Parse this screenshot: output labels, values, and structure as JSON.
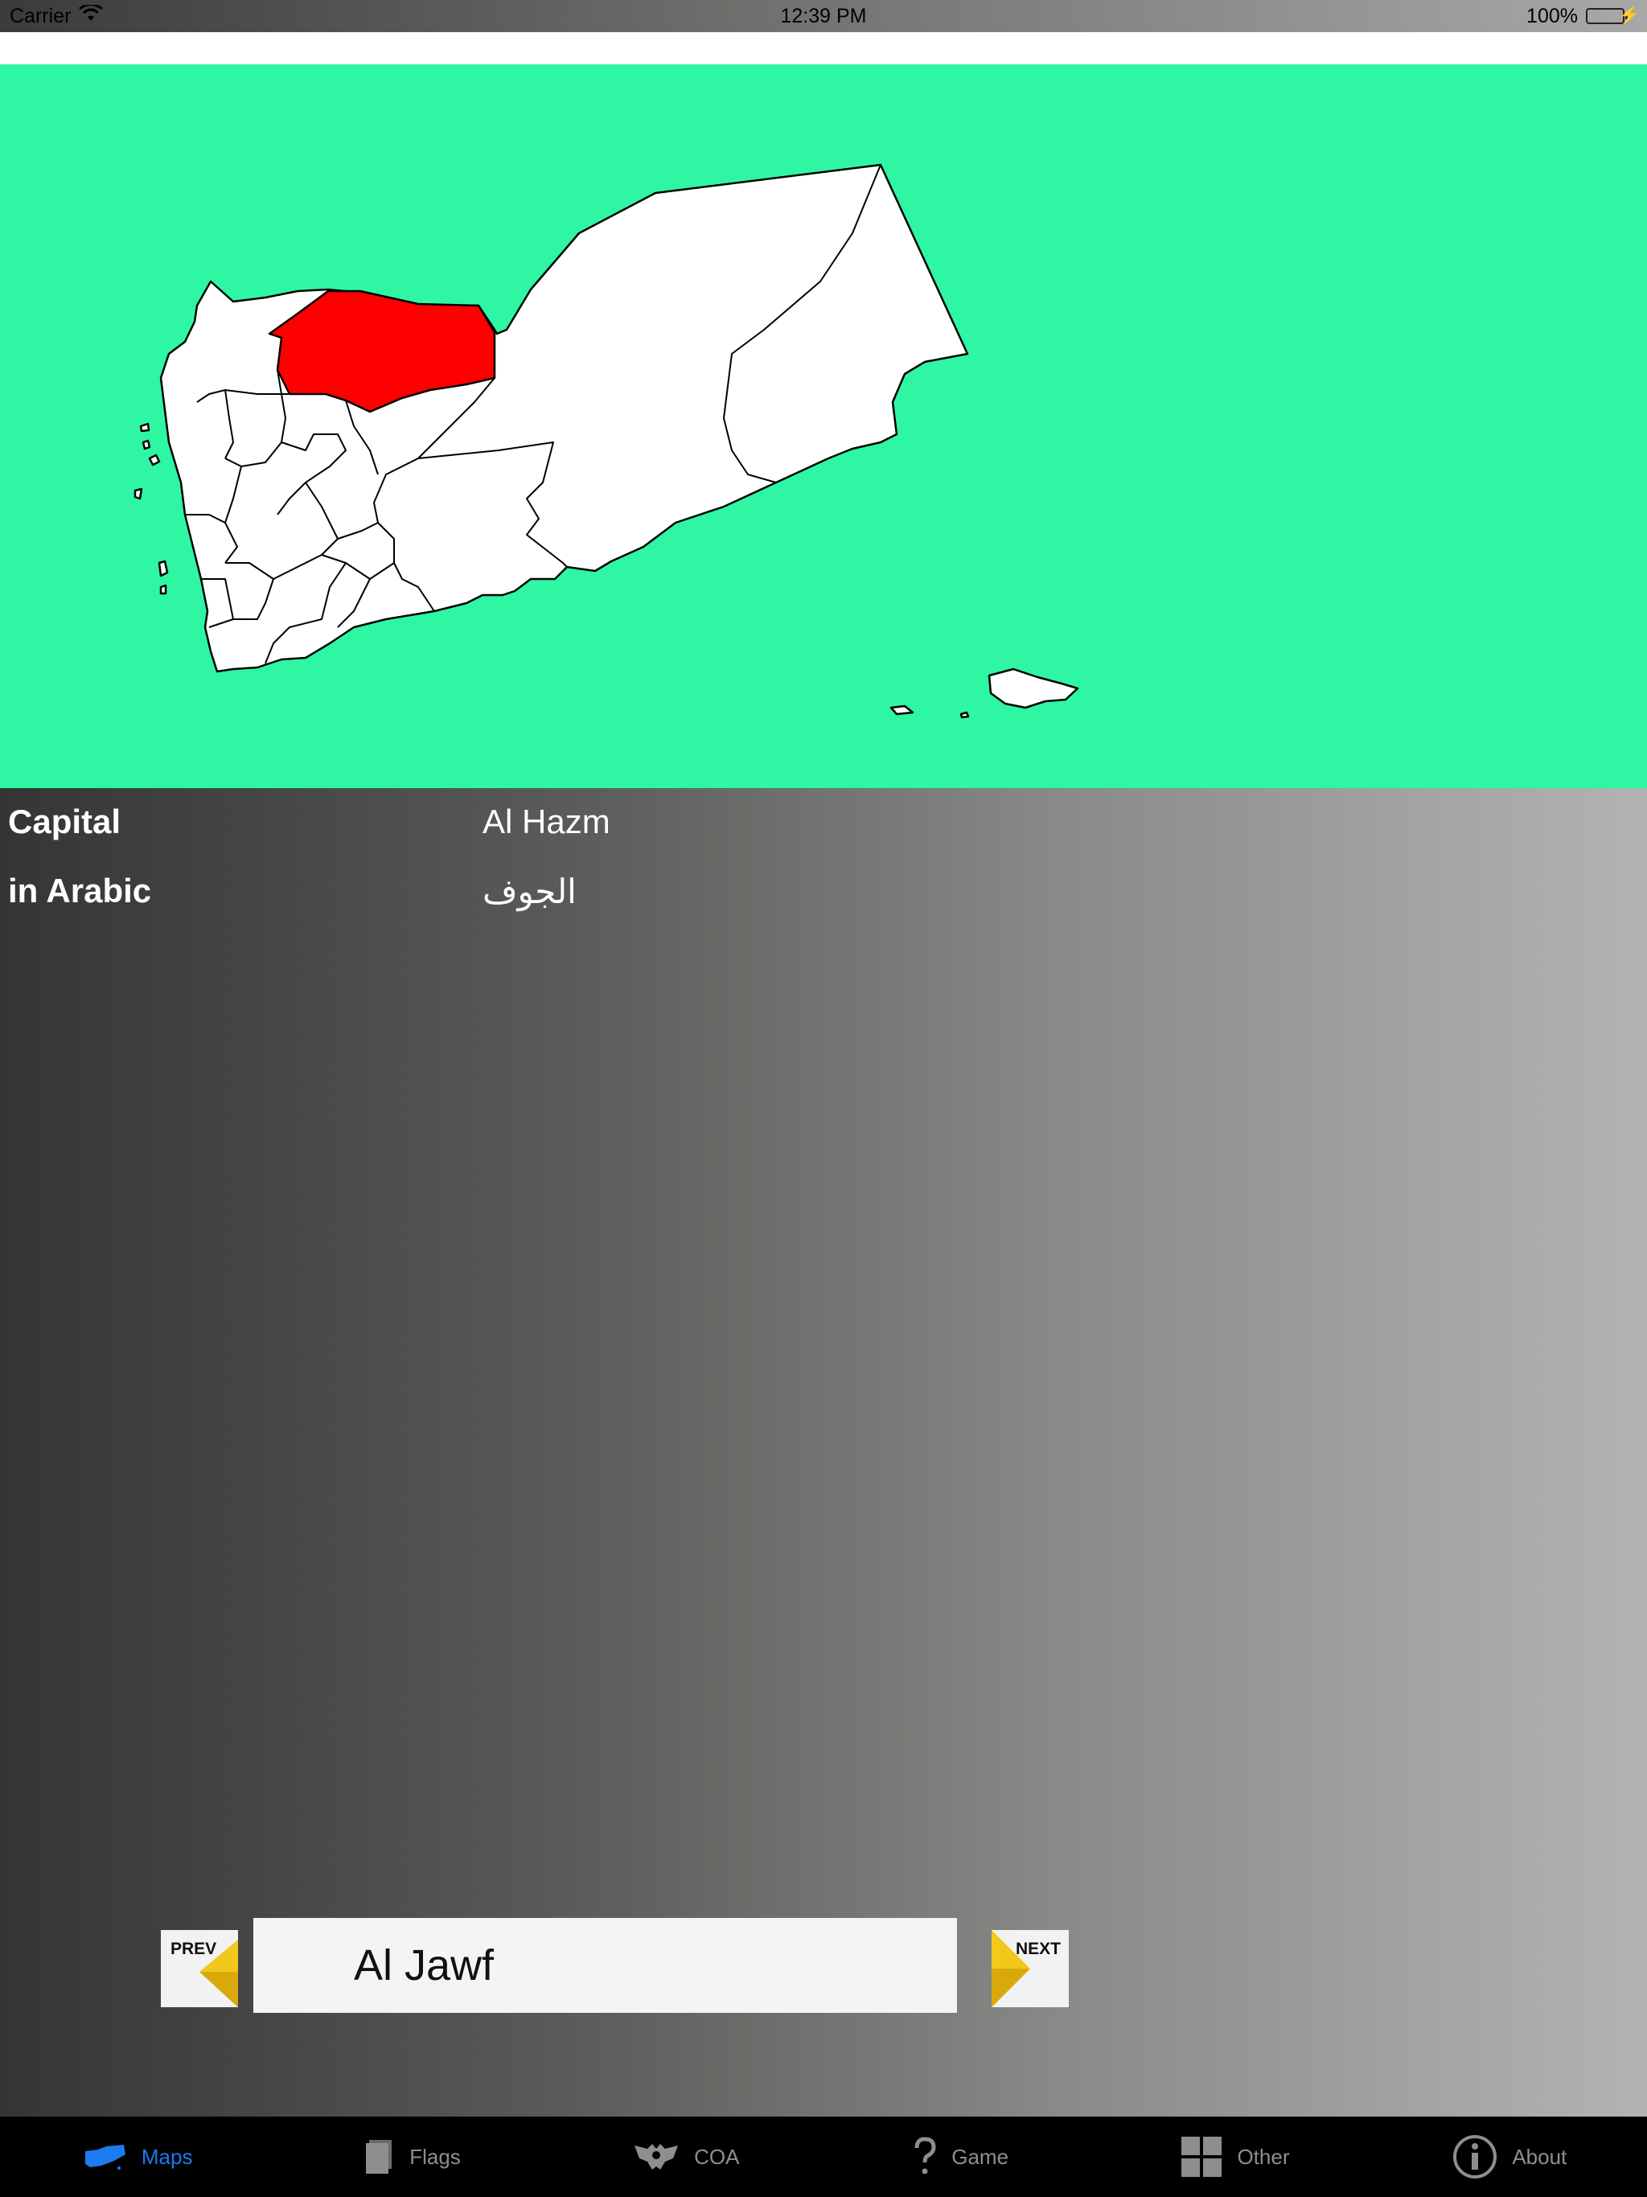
{
  "status_bar": {
    "carrier": "Carrier",
    "time": "12:39 PM",
    "battery": "100%"
  },
  "map": {
    "highlighted_region": "Al Jawf",
    "colors": {
      "sea": "#2ef6a3",
      "land": "#ffffff",
      "highlight": "#ff0000",
      "border": "#000000"
    }
  },
  "info": {
    "capital_label": "Capital",
    "capital_value": "Al Hazm",
    "arabic_label": "in Arabic",
    "arabic_value": "الجوف"
  },
  "navigator": {
    "prev_label": "PREV",
    "next_label": "NEXT",
    "current_name": "Al Jawf"
  },
  "tabs": [
    {
      "label": "Maps",
      "icon": "yemen-map-icon",
      "active": true
    },
    {
      "label": "Flags",
      "icon": "flag-icon",
      "active": false
    },
    {
      "label": "COA",
      "icon": "eagle-icon",
      "active": false
    },
    {
      "label": "Game",
      "icon": "question-icon",
      "active": false
    },
    {
      "label": "Other",
      "icon": "grid-icon",
      "active": false
    },
    {
      "label": "About",
      "icon": "info-icon",
      "active": false
    }
  ],
  "colors": {
    "active_tab": "#1a7cf0",
    "inactive_tab": "#8e8e8e",
    "arrow": "#f2c81b"
  }
}
